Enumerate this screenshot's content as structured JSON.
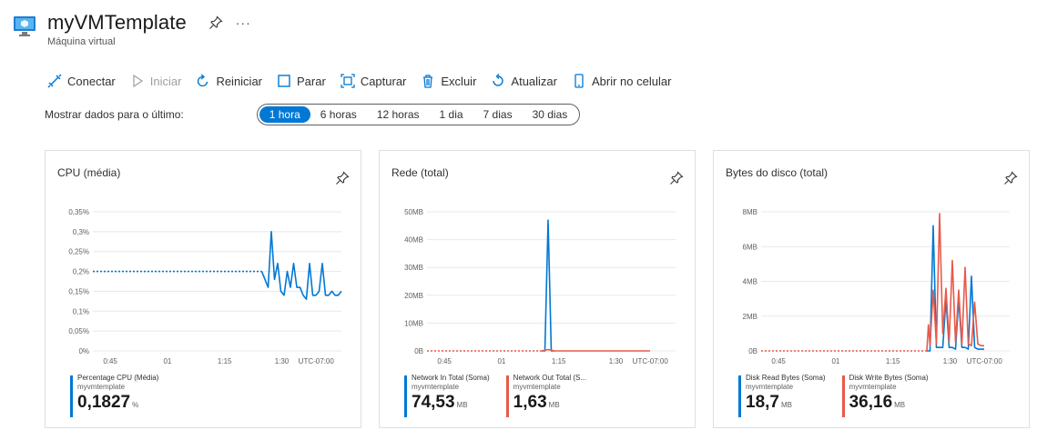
{
  "header": {
    "title": "myVMTemplate",
    "subtitle": "Máquina virtual",
    "more": "···"
  },
  "toolbar": [
    {
      "label": "Conectar",
      "icon": "connect-icon",
      "enabled": true
    },
    {
      "label": "Iniciar",
      "icon": "play-icon",
      "enabled": false
    },
    {
      "label": "Reiniciar",
      "icon": "restart-icon",
      "enabled": true
    },
    {
      "label": "Parar",
      "icon": "stop-icon",
      "enabled": true
    },
    {
      "label": "Capturar",
      "icon": "capture-icon",
      "enabled": true
    },
    {
      "label": "Excluir",
      "icon": "trash-icon",
      "enabled": true
    },
    {
      "label": "Atualizar",
      "icon": "refresh-icon",
      "enabled": true
    },
    {
      "label": "Abrir no celular",
      "icon": "mobile-icon",
      "enabled": true
    }
  ],
  "time_range": {
    "label": "Mostrar dados para o último:",
    "options": [
      "1 hora",
      "6 horas",
      "12 horas",
      "1 dia",
      "7 dias",
      "30 dias"
    ],
    "selected": "1 hora"
  },
  "colors": {
    "accent": "#0078d4",
    "series_red": "#e8594a",
    "border": "#e1dfdd"
  },
  "chart_data": [
    {
      "type": "line",
      "title": "CPU (média)",
      "x_ticks": [
        "0:45",
        "01",
        "1:15",
        "1:30",
        "UTC-07:00"
      ],
      "y_ticks": [
        "0%",
        "0,05%",
        "0,1%",
        "0,15%",
        "0,2%",
        "0,25%",
        "0,3%",
        "0,35%"
      ],
      "ylim": [
        0,
        0.35
      ],
      "series": [
        {
          "name": "Percentage CPU (Média)",
          "resource": "myvmtemplate",
          "summary_value": "0,1827",
          "summary_unit": "%",
          "color": "#0078d4",
          "dotted_until_minute": 53,
          "points": [
            [
              0,
              0.2
            ],
            [
              53,
              0.2
            ],
            [
              54,
              0.18
            ],
            [
              55,
              0.16
            ],
            [
              56,
              0.3
            ],
            [
              57,
              0.18
            ],
            [
              58,
              0.22
            ],
            [
              59,
              0.15
            ],
            [
              60,
              0.14
            ],
            [
              61,
              0.2
            ],
            [
              62,
              0.16
            ],
            [
              63,
              0.22
            ],
            [
              64,
              0.16
            ],
            [
              65,
              0.16
            ],
            [
              66,
              0.14
            ],
            [
              67,
              0.13
            ],
            [
              68,
              0.22
            ],
            [
              69,
              0.14
            ],
            [
              70,
              0.14
            ],
            [
              71,
              0.15
            ],
            [
              72,
              0.22
            ],
            [
              73,
              0.14
            ],
            [
              74,
              0.14
            ],
            [
              75,
              0.15
            ],
            [
              76,
              0.14
            ],
            [
              77,
              0.14
            ],
            [
              78,
              0.15
            ]
          ]
        }
      ]
    },
    {
      "type": "line",
      "title": "Rede (total)",
      "x_ticks": [
        "0:45",
        "01",
        "1:15",
        "1:30",
        "UTC-07:00"
      ],
      "y_ticks": [
        "0B",
        "10MB",
        "20MB",
        "30MB",
        "40MB",
        "50MB"
      ],
      "ylim": [
        0,
        50
      ],
      "series": [
        {
          "name": "Network In Total (Soma)",
          "resource": "myvmtemplate",
          "summary_value": "74,53",
          "summary_unit": "MB",
          "color": "#0078d4",
          "dotted_until_minute": 0,
          "points": [
            [
              36,
              0
            ],
            [
              37,
              0
            ],
            [
              38,
              47
            ],
            [
              39,
              0
            ],
            [
              40,
              0
            ]
          ]
        },
        {
          "name": "Network Out Total (S...",
          "resource": "myvmtemplate",
          "summary_value": "1,63",
          "summary_unit": "MB",
          "color": "#e8594a",
          "dotted_until_minute": 36,
          "points": [
            [
              0,
              0
            ],
            [
              36,
              0
            ],
            [
              38,
              0.5
            ],
            [
              40,
              0
            ],
            [
              70,
              0
            ]
          ]
        }
      ]
    },
    {
      "type": "line",
      "title": "Bytes do disco (total)",
      "x_ticks": [
        "0:45",
        "01",
        "1:15",
        "1:30",
        "UTC-07:00"
      ],
      "y_ticks": [
        "0B",
        "2MB",
        "4MB",
        "6MB",
        "8MB"
      ],
      "ylim": [
        0,
        8
      ],
      "series": [
        {
          "name": "Disk Read Bytes (Soma)",
          "resource": "myvmtemplate",
          "summary_value": "18,7",
          "summary_unit": "MB",
          "color": "#0078d4",
          "dotted_until_minute": 0,
          "points": [
            [
              52,
              0
            ],
            [
              53,
              0
            ],
            [
              54,
              7.2
            ],
            [
              55,
              0.2
            ],
            [
              56,
              0.2
            ],
            [
              57,
              0.2
            ],
            [
              58,
              3
            ],
            [
              59,
              0.2
            ],
            [
              60,
              0.2
            ],
            [
              61,
              0.1
            ],
            [
              62,
              3
            ],
            [
              63,
              0.2
            ],
            [
              64,
              0.2
            ],
            [
              65,
              0.1
            ],
            [
              66,
              4.3
            ],
            [
              67,
              0.2
            ],
            [
              68,
              0.1
            ],
            [
              69,
              0.1
            ],
            [
              70,
              0.1
            ]
          ]
        },
        {
          "name": "Disk Write Bytes (Soma)",
          "resource": "myvmtemplate",
          "summary_value": "36,16",
          "summary_unit": "MB",
          "color": "#e8594a",
          "dotted_until_minute": 52,
          "points": [
            [
              0,
              0
            ],
            [
              52,
              0
            ],
            [
              52.5,
              1.5
            ],
            [
              53,
              0.3
            ],
            [
              54,
              3.5
            ],
            [
              55,
              0.4
            ],
            [
              56,
              7.9
            ],
            [
              57,
              1
            ],
            [
              58,
              3.6
            ],
            [
              59,
              0.5
            ],
            [
              60,
              5.2
            ],
            [
              61,
              0.5
            ],
            [
              62,
              3.5
            ],
            [
              63,
              0.4
            ],
            [
              64,
              4.8
            ],
            [
              65,
              0.4
            ],
            [
              66,
              0.3
            ],
            [
              67,
              2.8
            ],
            [
              68,
              0.4
            ],
            [
              69,
              0.3
            ],
            [
              70,
              0.3
            ]
          ]
        }
      ]
    }
  ]
}
